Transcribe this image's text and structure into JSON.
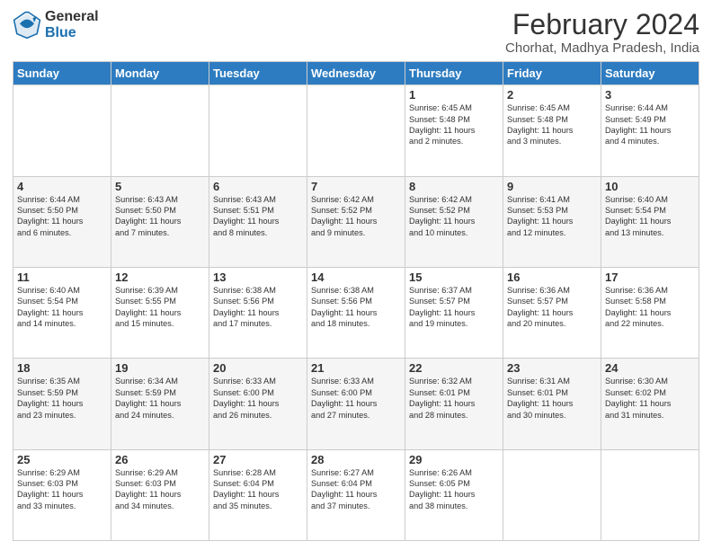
{
  "header": {
    "logo_general": "General",
    "logo_blue": "Blue",
    "month_year": "February 2024",
    "location": "Chorhat, Madhya Pradesh, India"
  },
  "weekdays": [
    "Sunday",
    "Monday",
    "Tuesday",
    "Wednesday",
    "Thursday",
    "Friday",
    "Saturday"
  ],
  "weeks": [
    [
      {
        "day": "",
        "info": ""
      },
      {
        "day": "",
        "info": ""
      },
      {
        "day": "",
        "info": ""
      },
      {
        "day": "",
        "info": ""
      },
      {
        "day": "1",
        "info": "Sunrise: 6:45 AM\nSunset: 5:48 PM\nDaylight: 11 hours\nand 2 minutes."
      },
      {
        "day": "2",
        "info": "Sunrise: 6:45 AM\nSunset: 5:48 PM\nDaylight: 11 hours\nand 3 minutes."
      },
      {
        "day": "3",
        "info": "Sunrise: 6:44 AM\nSunset: 5:49 PM\nDaylight: 11 hours\nand 4 minutes."
      }
    ],
    [
      {
        "day": "4",
        "info": "Sunrise: 6:44 AM\nSunset: 5:50 PM\nDaylight: 11 hours\nand 6 minutes."
      },
      {
        "day": "5",
        "info": "Sunrise: 6:43 AM\nSunset: 5:50 PM\nDaylight: 11 hours\nand 7 minutes."
      },
      {
        "day": "6",
        "info": "Sunrise: 6:43 AM\nSunset: 5:51 PM\nDaylight: 11 hours\nand 8 minutes."
      },
      {
        "day": "7",
        "info": "Sunrise: 6:42 AM\nSunset: 5:52 PM\nDaylight: 11 hours\nand 9 minutes."
      },
      {
        "day": "8",
        "info": "Sunrise: 6:42 AM\nSunset: 5:52 PM\nDaylight: 11 hours\nand 10 minutes."
      },
      {
        "day": "9",
        "info": "Sunrise: 6:41 AM\nSunset: 5:53 PM\nDaylight: 11 hours\nand 12 minutes."
      },
      {
        "day": "10",
        "info": "Sunrise: 6:40 AM\nSunset: 5:54 PM\nDaylight: 11 hours\nand 13 minutes."
      }
    ],
    [
      {
        "day": "11",
        "info": "Sunrise: 6:40 AM\nSunset: 5:54 PM\nDaylight: 11 hours\nand 14 minutes."
      },
      {
        "day": "12",
        "info": "Sunrise: 6:39 AM\nSunset: 5:55 PM\nDaylight: 11 hours\nand 15 minutes."
      },
      {
        "day": "13",
        "info": "Sunrise: 6:38 AM\nSunset: 5:56 PM\nDaylight: 11 hours\nand 17 minutes."
      },
      {
        "day": "14",
        "info": "Sunrise: 6:38 AM\nSunset: 5:56 PM\nDaylight: 11 hours\nand 18 minutes."
      },
      {
        "day": "15",
        "info": "Sunrise: 6:37 AM\nSunset: 5:57 PM\nDaylight: 11 hours\nand 19 minutes."
      },
      {
        "day": "16",
        "info": "Sunrise: 6:36 AM\nSunset: 5:57 PM\nDaylight: 11 hours\nand 20 minutes."
      },
      {
        "day": "17",
        "info": "Sunrise: 6:36 AM\nSunset: 5:58 PM\nDaylight: 11 hours\nand 22 minutes."
      }
    ],
    [
      {
        "day": "18",
        "info": "Sunrise: 6:35 AM\nSunset: 5:59 PM\nDaylight: 11 hours\nand 23 minutes."
      },
      {
        "day": "19",
        "info": "Sunrise: 6:34 AM\nSunset: 5:59 PM\nDaylight: 11 hours\nand 24 minutes."
      },
      {
        "day": "20",
        "info": "Sunrise: 6:33 AM\nSunset: 6:00 PM\nDaylight: 11 hours\nand 26 minutes."
      },
      {
        "day": "21",
        "info": "Sunrise: 6:33 AM\nSunset: 6:00 PM\nDaylight: 11 hours\nand 27 minutes."
      },
      {
        "day": "22",
        "info": "Sunrise: 6:32 AM\nSunset: 6:01 PM\nDaylight: 11 hours\nand 28 minutes."
      },
      {
        "day": "23",
        "info": "Sunrise: 6:31 AM\nSunset: 6:01 PM\nDaylight: 11 hours\nand 30 minutes."
      },
      {
        "day": "24",
        "info": "Sunrise: 6:30 AM\nSunset: 6:02 PM\nDaylight: 11 hours\nand 31 minutes."
      }
    ],
    [
      {
        "day": "25",
        "info": "Sunrise: 6:29 AM\nSunset: 6:03 PM\nDaylight: 11 hours\nand 33 minutes."
      },
      {
        "day": "26",
        "info": "Sunrise: 6:29 AM\nSunset: 6:03 PM\nDaylight: 11 hours\nand 34 minutes."
      },
      {
        "day": "27",
        "info": "Sunrise: 6:28 AM\nSunset: 6:04 PM\nDaylight: 11 hours\nand 35 minutes."
      },
      {
        "day": "28",
        "info": "Sunrise: 6:27 AM\nSunset: 6:04 PM\nDaylight: 11 hours\nand 37 minutes."
      },
      {
        "day": "29",
        "info": "Sunrise: 6:26 AM\nSunset: 6:05 PM\nDaylight: 11 hours\nand 38 minutes."
      },
      {
        "day": "",
        "info": ""
      },
      {
        "day": "",
        "info": ""
      }
    ]
  ]
}
